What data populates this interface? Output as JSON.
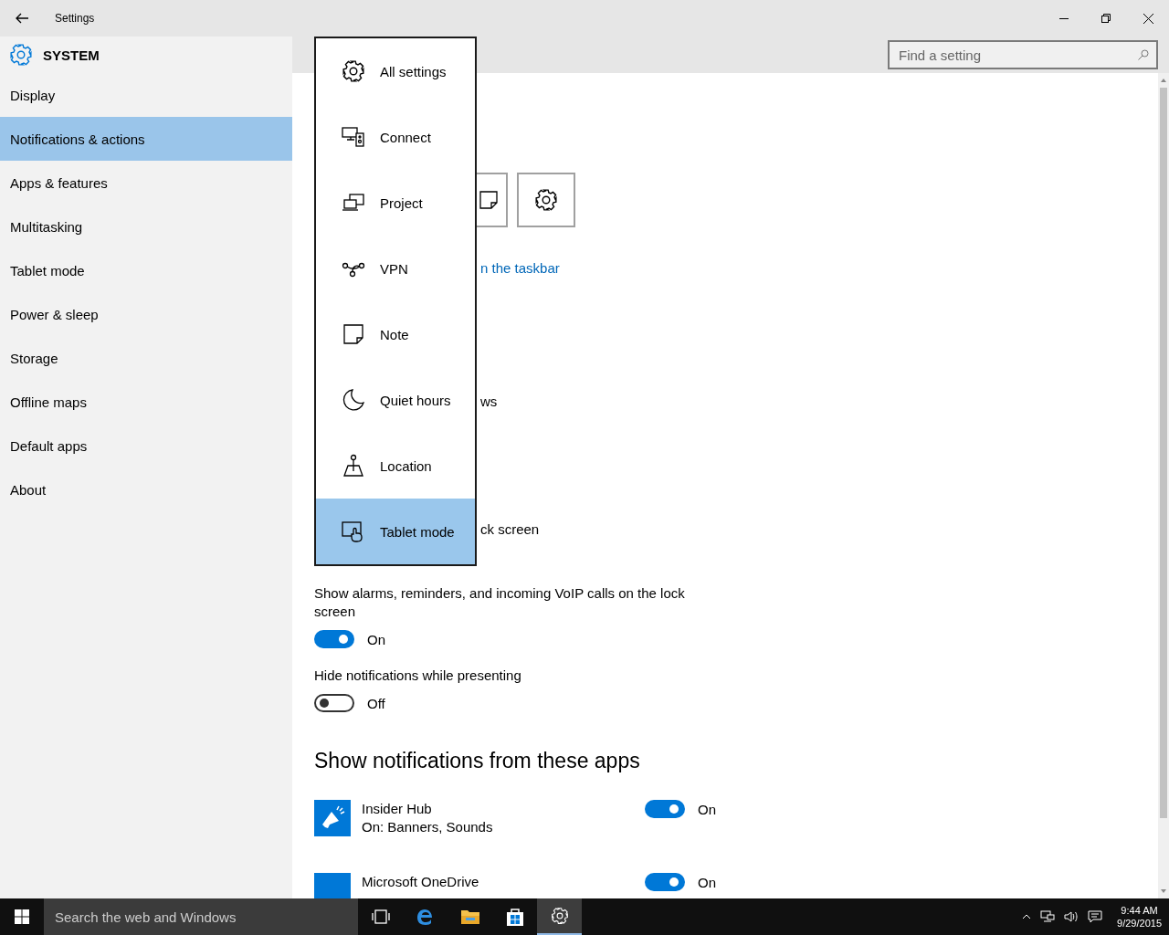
{
  "window": {
    "title": "Settings"
  },
  "header": {
    "title": "SYSTEM"
  },
  "search": {
    "placeholder": "Find a setting"
  },
  "sidebar": {
    "items": [
      {
        "label": "Display",
        "selected": false
      },
      {
        "label": "Notifications & actions",
        "selected": true
      },
      {
        "label": "Apps & features",
        "selected": false
      },
      {
        "label": "Multitasking",
        "selected": false
      },
      {
        "label": "Tablet mode",
        "selected": false
      },
      {
        "label": "Power & sleep",
        "selected": false
      },
      {
        "label": "Storage",
        "selected": false
      },
      {
        "label": "Offline maps",
        "selected": false
      },
      {
        "label": "Default apps",
        "selected": false
      },
      {
        "label": "About",
        "selected": false
      }
    ]
  },
  "quick_action_menu": {
    "items": [
      {
        "label": "All settings",
        "selected": false
      },
      {
        "label": "Connect",
        "selected": false
      },
      {
        "label": "Project",
        "selected": false
      },
      {
        "label": "VPN",
        "selected": false
      },
      {
        "label": "Note",
        "selected": false
      },
      {
        "label": "Quiet hours",
        "selected": false
      },
      {
        "label": "Location",
        "selected": false
      },
      {
        "label": "Tablet mode",
        "selected": true
      }
    ]
  },
  "behind_menu": [
    {
      "kind": "link",
      "text": "n the taskbar"
    },
    {
      "kind": "text",
      "text": "ws"
    },
    {
      "kind": "text",
      "text": "ck screen"
    }
  ],
  "toggles": [
    {
      "label": "Show alarms, reminders, and incoming VoIP calls on the lock screen",
      "on": true,
      "state_text": "On"
    },
    {
      "label": "Hide notifications while presenting",
      "on": false,
      "state_text": "Off"
    }
  ],
  "apps_heading": "Show notifications from these apps",
  "apps": [
    {
      "name": "Insider Hub",
      "detail": "On: Banners, Sounds",
      "on": true,
      "state_text": "On"
    },
    {
      "name": "Microsoft OneDrive",
      "on": true,
      "state_text": "On"
    }
  ],
  "taskbar": {
    "search_placeholder": "Search the web and Windows",
    "apps": [
      {
        "active": false
      },
      {
        "active": false
      },
      {
        "active": false
      },
      {
        "active": false
      },
      {
        "active": true
      }
    ],
    "time": "9:44 AM",
    "date": "9/29/2015"
  }
}
